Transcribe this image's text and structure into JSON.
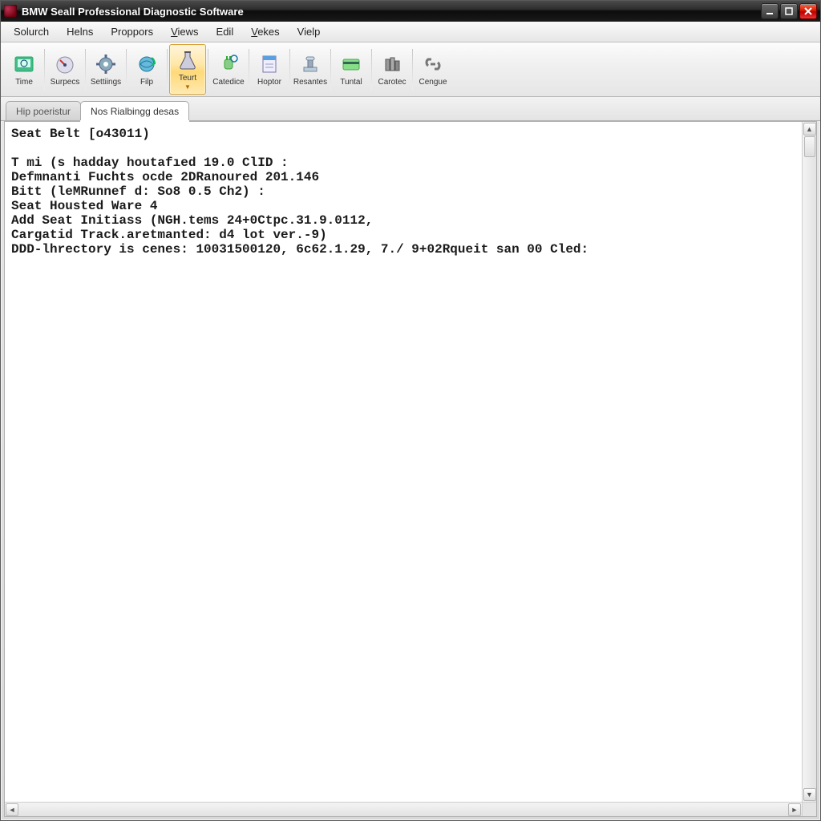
{
  "titlebar": {
    "title": "BMW Seall Professional Diagnostic Software"
  },
  "menus": [
    "Solurch",
    "Helns",
    "Proppors",
    "Views",
    "Edil",
    "Vekes",
    "Vielp"
  ],
  "menu_underline_index": {
    "Views": 0,
    "Vekes": 0
  },
  "toolbar": [
    {
      "id": "time",
      "label": "Time",
      "icon": "clock"
    },
    {
      "id": "surpecs",
      "label": "Surpecs",
      "icon": "gauge"
    },
    {
      "id": "settings",
      "label": "Settiings",
      "icon": "gear"
    },
    {
      "id": "file",
      "label": "Filp",
      "icon": "globe-refresh"
    },
    {
      "id": "teurt",
      "label": "Teurt",
      "icon": "flask",
      "active": true,
      "dropdown": true
    },
    {
      "id": "catedice",
      "label": "Catedice",
      "icon": "plug-refresh"
    },
    {
      "id": "hoptor",
      "label": "Hoptor",
      "icon": "document"
    },
    {
      "id": "resantes",
      "label": "Resantes",
      "icon": "stamp"
    },
    {
      "id": "tuntal",
      "label": "Tuntal",
      "icon": "card"
    },
    {
      "id": "carotec",
      "label": "Carotec",
      "icon": "cylinders"
    },
    {
      "id": "cengue",
      "label": "Cengue",
      "icon": "link"
    }
  ],
  "tabs": [
    {
      "id": "hip",
      "label": "Hip poeristur",
      "active": false
    },
    {
      "id": "nos",
      "label": "Nos  Rialbingg desas",
      "active": true
    }
  ],
  "output_lines": [
    "Seat Belt [o43011)",
    "",
    "T mi (s hadday houtafıed 19.0 ClID :",
    "Defmnanti Fuchts ocde 2DRanoured 201.146",
    "Bitt (leMRunnef d: So8 0.5 Ch2) :",
    "Seat Housted Ware 4",
    "Add Seat Initiass (NGH.tems 24+0Ctpc.31.9.0112,",
    "Cargatid Track.aretmanted: d4 lot ver.-9)",
    "DDD-lhrectory is cenes: 10031500120, 6c62.1.29, 7./ 9+02Rqueit san 00 Cled:"
  ]
}
